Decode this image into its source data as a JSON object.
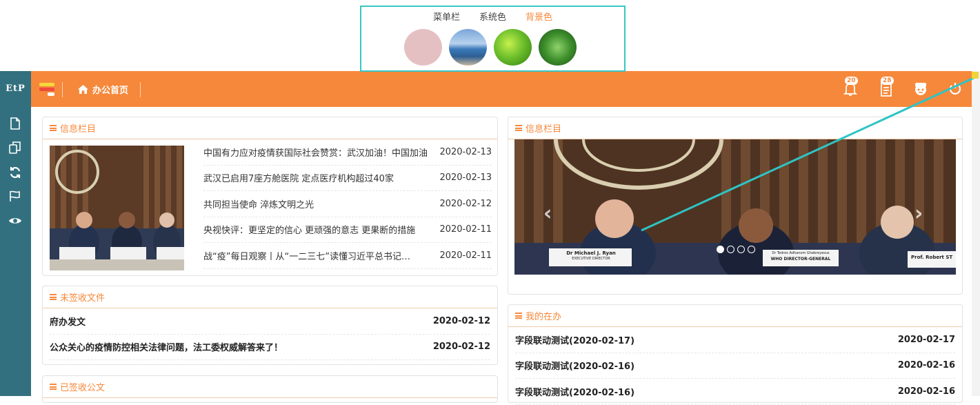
{
  "theme_picker": {
    "tabs": [
      {
        "label": "菜单栏",
        "active": false
      },
      {
        "label": "系统色",
        "active": false
      },
      {
        "label": "背景色",
        "active": true
      }
    ],
    "swatches": [
      "pink",
      "sea",
      "leaf",
      "clover"
    ]
  },
  "sidebar": {
    "logo": "EtP",
    "icons": [
      "file-icon",
      "copy-icon",
      "refresh-icon",
      "flag-icon",
      "eye-icon"
    ]
  },
  "header": {
    "home_label": "办公首页",
    "notifications_count": "20",
    "documents_count": "28",
    "background_color": "#f6883b"
  },
  "info_panel_left": {
    "title": "信息栏目",
    "news": [
      {
        "title": "中国有力应对疫情获国际社会赞赏：武汉加油！中国加油",
        "date": "2020-02-13"
      },
      {
        "title": "武汉已启用7座方舱医院 定点医疗机构超过40家",
        "date": "2020-02-13"
      },
      {
        "title": "共同担当使命 淬炼文明之光",
        "date": "2020-02-12"
      },
      {
        "title": "央视快评：更坚定的信心 更顽强的意志 更果断的措施",
        "date": "2020-02-11"
      },
      {
        "title": "战“疫”每日观察丨从“一二三七”读懂习近平总书记…",
        "date": "2020-02-11"
      }
    ]
  },
  "info_panel_right": {
    "title": "信息栏目",
    "nameplates": [
      "Dr Michael J. Ryan",
      "EXECUTIVE DIRECTOR",
      "Dr Tedros Adhanom Ghebreyesus",
      "WHO DIRECTOR-GENERAL",
      "Prof. Robert ST"
    ]
  },
  "unsigned_docs": {
    "title": "未签收文件",
    "rows": [
      {
        "title": "府办发文",
        "date": "2020-02-12"
      },
      {
        "title": "公众关心的疫情防控相关法律问题，法工委权威解答来了！",
        "date": "2020-02-12"
      }
    ]
  },
  "signed_docs": {
    "title": "已签收公文"
  },
  "my_tasks": {
    "title": "我的在办",
    "rows": [
      {
        "title": "字段联动测试(2020-02-17)",
        "date": "2020-02-17"
      },
      {
        "title": "字段联动测试(2020-02-16)",
        "date": "2020-02-16"
      },
      {
        "title": "字段联动测试(2020-02-16)",
        "date": "2020-02-16"
      }
    ]
  },
  "colors": {
    "accent": "#f6883b",
    "sidebar": "#33707f",
    "picker_border": "#37c6c6"
  }
}
